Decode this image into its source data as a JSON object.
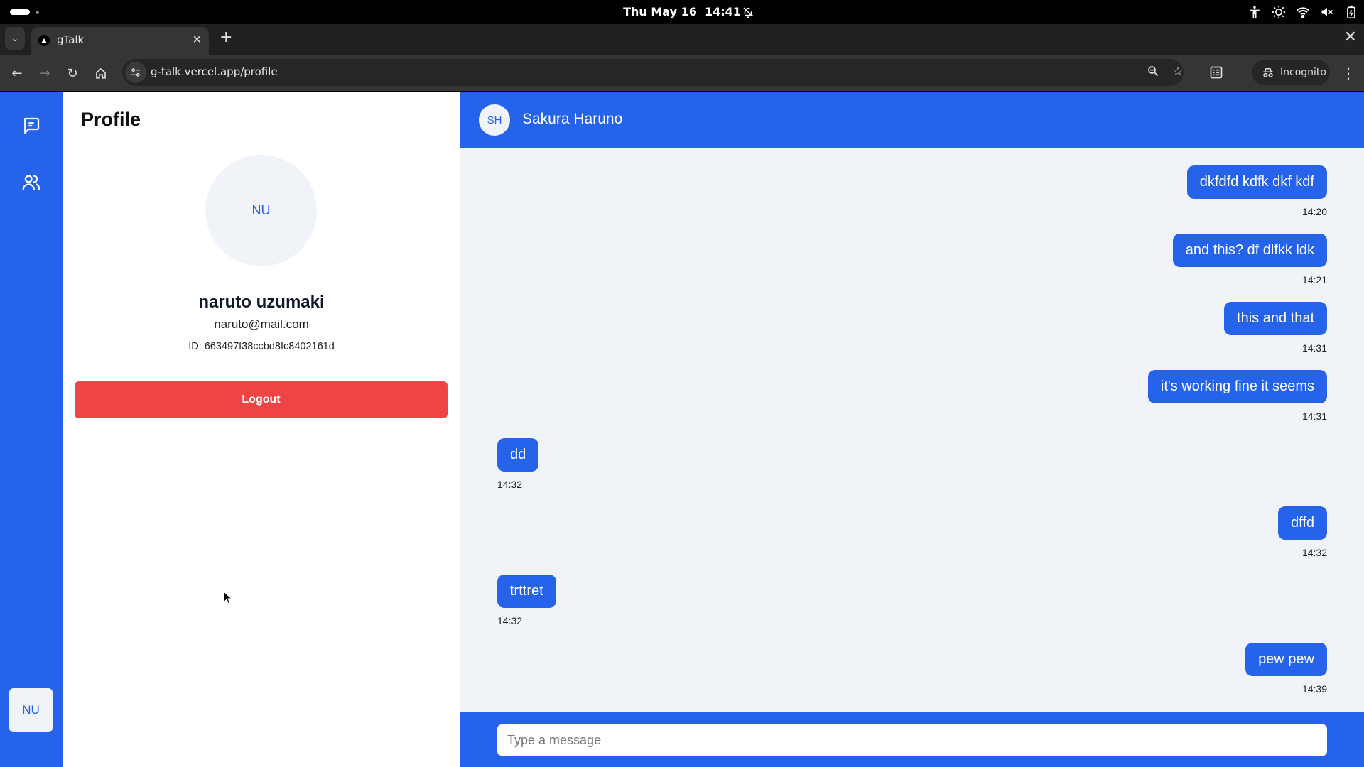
{
  "os": {
    "date": "Thu May 16",
    "time": "14:41"
  },
  "browser": {
    "tab_title": "gTalk",
    "url": "g-talk.vercel.app/profile",
    "incognito_label": "Incognito",
    "icons": {
      "tab_search": "chevron-down-icon",
      "back": "arrow-left-icon",
      "forward": "arrow-right-icon",
      "reload": "reload-icon",
      "home": "home-icon",
      "zoom": "zoom-out-icon",
      "bookmark": "star-icon",
      "reader": "reading-list-icon",
      "menu": "kebab-menu-icon"
    }
  },
  "sidebar": {
    "items": [
      {
        "name": "chats",
        "icon": "chat-icon"
      },
      {
        "name": "contacts",
        "icon": "users-icon"
      }
    ],
    "user_initials": "NU"
  },
  "profile": {
    "title": "Profile",
    "initials": "NU",
    "name": "naruto uzumaki",
    "email": "naruto@mail.com",
    "id_label": "ID: 663497f38ccbd8fc8402161d",
    "logout_label": "Logout",
    "logout_color": "#ef4444"
  },
  "chat": {
    "contact_initials": "SH",
    "contact_name": "Sakura Haruno",
    "accent": "#2563eb",
    "messages": [
      {
        "direction": "out",
        "text": "dkfdfd kdfk dkf kdf",
        "time": "14:20"
      },
      {
        "direction": "out",
        "text": "and this? df dlfkk ldk",
        "time": "14:21"
      },
      {
        "direction": "out",
        "text": "this and that",
        "time": "14:31"
      },
      {
        "direction": "out",
        "text": "it's working fine it seems",
        "time": "14:31"
      },
      {
        "direction": "in",
        "text": "dd",
        "time": "14:32"
      },
      {
        "direction": "out",
        "text": "dffd",
        "time": "14:32"
      },
      {
        "direction": "in",
        "text": "trttret",
        "time": "14:32"
      },
      {
        "direction": "out",
        "text": "pew pew",
        "time": "14:39"
      }
    ],
    "input_placeholder": "Type a message",
    "input_value": ""
  }
}
